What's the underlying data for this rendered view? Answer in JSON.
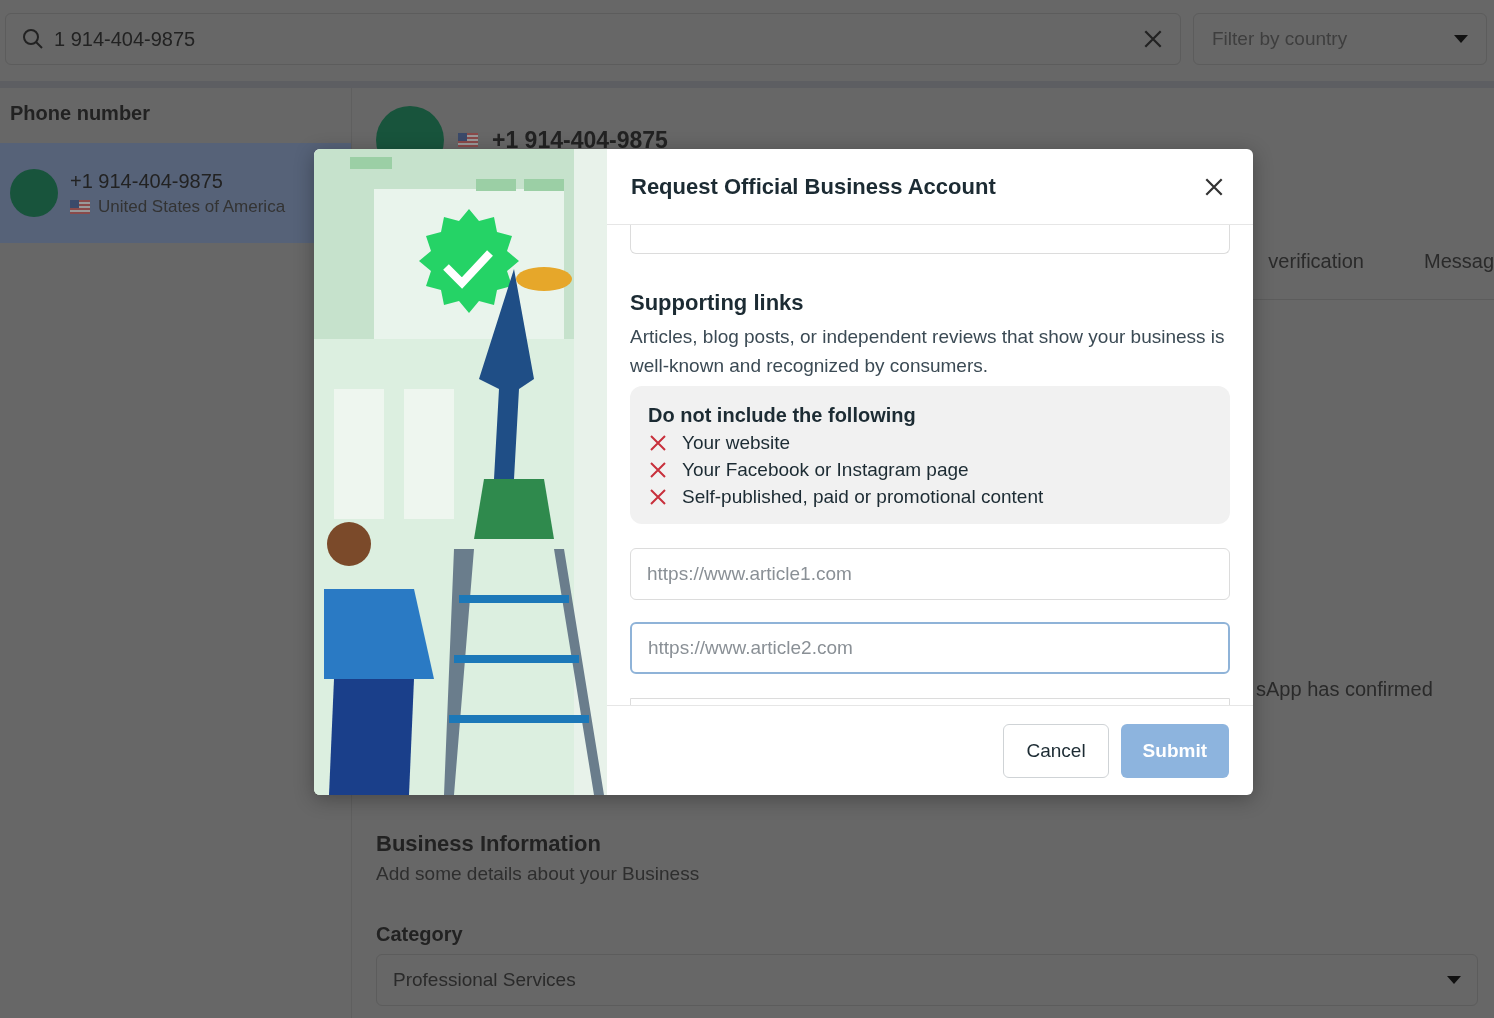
{
  "search": {
    "value": "1 914-404-9875"
  },
  "country_filter": {
    "placeholder": "Filter by country"
  },
  "sidebar": {
    "heading": "Phone number",
    "items": [
      {
        "number": "+1 914-404-9875",
        "country": "United States of America",
        "selected": true
      }
    ]
  },
  "detail": {
    "number": "+1 914-404-9875",
    "tabs": [
      {
        "label": "verification"
      },
      {
        "label": "Messag"
      }
    ],
    "notice": "sApp has confirmed",
    "business_info": {
      "title": "Business Information",
      "subtitle": "Add some details about your Business"
    },
    "category": {
      "label": "Category",
      "value": "Professional Services"
    }
  },
  "dialog": {
    "title": "Request Official Business Account",
    "section": {
      "title": "Supporting links",
      "description": "Articles, blog posts, or independent reviews that show your business is well-known and recognized by consumers."
    },
    "exclusions": {
      "title": "Do not include the following",
      "items": [
        "Your website",
        "Your Facebook or Instagram page",
        "Self-published, paid or promotional content"
      ]
    },
    "link_fields": [
      {
        "placeholder": "https://www.article1.com",
        "focused": false
      },
      {
        "placeholder": "https://www.article2.com",
        "focused": true
      }
    ],
    "buttons": [
      {
        "label": "Cancel",
        "kind": "secondary",
        "disabled": false
      },
      {
        "label": "Submit",
        "kind": "primary",
        "disabled": true
      }
    ]
  }
}
